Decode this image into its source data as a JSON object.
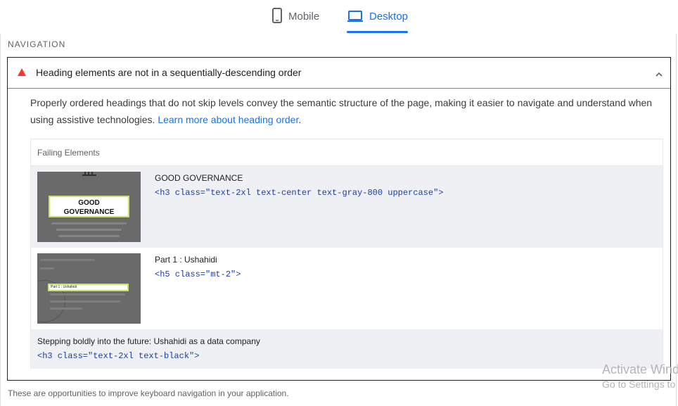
{
  "tabs": {
    "mobile_label": "Mobile",
    "desktop_label": "Desktop",
    "active": "Desktop",
    "accent": "#1a73e8"
  },
  "section": {
    "title": "NAVIGATION"
  },
  "audit": {
    "status_icon": "warning-triangle-icon",
    "status_color": "#ff3333",
    "title": "Heading elements are not in a sequentially-descending order",
    "expanded": true,
    "description": "Properly ordered headings that do not skip levels convey the semantic structure of the page, making it easier to navigate and understand when using assistive technologies.",
    "learn_more": "Learn more about heading order",
    "learn_more_suffix": "."
  },
  "failing": {
    "header": "Failing Elements",
    "items": [
      {
        "label": "GOOD GOVERNANCE",
        "snippet": "<h3 class=\"text-2xl text-center text-gray-800 uppercase\">",
        "thumb_text_1": "GOOD",
        "thumb_text_2": "GOVERNANCE"
      },
      {
        "label": "Part 1 : Ushahidi",
        "snippet": "<h5 class=\"mt-2\">",
        "thumb_text_1": "Part 1 : Ushahidi"
      },
      {
        "label": "Stepping boldly into the future: Ushahidi as a data company",
        "snippet": "<h3 class=\"text-2xl text-black\">"
      }
    ]
  },
  "footer": {
    "note": "These are opportunities to improve keyboard navigation in your application."
  },
  "watermark": {
    "line1": "Activate Windows",
    "line2": "Go to Settings to activate Windows."
  }
}
